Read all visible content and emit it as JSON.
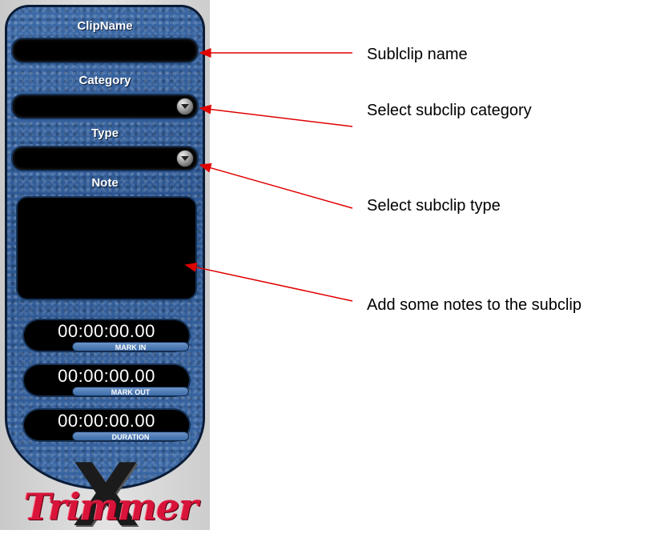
{
  "panel": {
    "clipname_label": "ClipName",
    "clipname_value": "",
    "category_label": "Category",
    "category_value": "",
    "type_label": "Type",
    "type_value": "",
    "note_label": "Note",
    "note_value": "",
    "mark_in": {
      "value": "00:00:00.00",
      "label": "MARK IN"
    },
    "mark_out": {
      "value": "00:00:00.00",
      "label": "MARK OUT"
    },
    "duration": {
      "value": "00:00:00.00",
      "label": "DURATION"
    }
  },
  "logo": {
    "text": "Trimmer",
    "letter": "X"
  },
  "annotations": [
    {
      "text": "Sublclip name"
    },
    {
      "text": "Select subclip category"
    },
    {
      "text": "Select subclip type"
    },
    {
      "text": "Add some notes to the subclip"
    }
  ],
  "colors": {
    "panel_blue": "#2f5b96",
    "field_black": "#000000",
    "arrow_red": "#e00000",
    "logo_red": "#d8143a"
  },
  "icons": {
    "dropdown": "chevron-down-icon",
    "logo": "trimmer-x-logo"
  }
}
